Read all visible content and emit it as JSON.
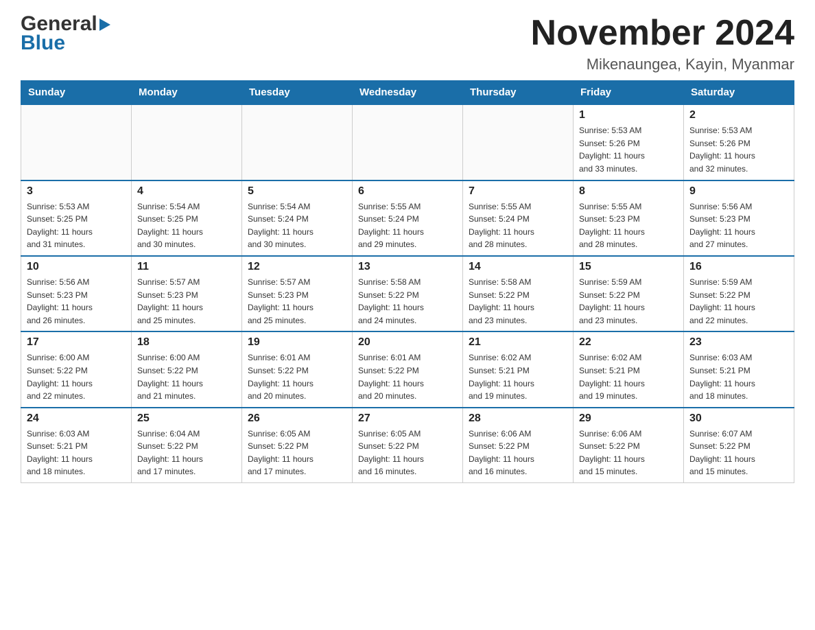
{
  "logo": {
    "general": "General",
    "arrow": "",
    "blue": "Blue"
  },
  "title": "November 2024",
  "location": "Mikenaungea, Kayin, Myanmar",
  "weekdays": [
    "Sunday",
    "Monday",
    "Tuesday",
    "Wednesday",
    "Thursday",
    "Friday",
    "Saturday"
  ],
  "weeks": [
    [
      {
        "day": "",
        "info": ""
      },
      {
        "day": "",
        "info": ""
      },
      {
        "day": "",
        "info": ""
      },
      {
        "day": "",
        "info": ""
      },
      {
        "day": "",
        "info": ""
      },
      {
        "day": "1",
        "info": "Sunrise: 5:53 AM\nSunset: 5:26 PM\nDaylight: 11 hours\nand 33 minutes."
      },
      {
        "day": "2",
        "info": "Sunrise: 5:53 AM\nSunset: 5:26 PM\nDaylight: 11 hours\nand 32 minutes."
      }
    ],
    [
      {
        "day": "3",
        "info": "Sunrise: 5:53 AM\nSunset: 5:25 PM\nDaylight: 11 hours\nand 31 minutes."
      },
      {
        "day": "4",
        "info": "Sunrise: 5:54 AM\nSunset: 5:25 PM\nDaylight: 11 hours\nand 30 minutes."
      },
      {
        "day": "5",
        "info": "Sunrise: 5:54 AM\nSunset: 5:24 PM\nDaylight: 11 hours\nand 30 minutes."
      },
      {
        "day": "6",
        "info": "Sunrise: 5:55 AM\nSunset: 5:24 PM\nDaylight: 11 hours\nand 29 minutes."
      },
      {
        "day": "7",
        "info": "Sunrise: 5:55 AM\nSunset: 5:24 PM\nDaylight: 11 hours\nand 28 minutes."
      },
      {
        "day": "8",
        "info": "Sunrise: 5:55 AM\nSunset: 5:23 PM\nDaylight: 11 hours\nand 28 minutes."
      },
      {
        "day": "9",
        "info": "Sunrise: 5:56 AM\nSunset: 5:23 PM\nDaylight: 11 hours\nand 27 minutes."
      }
    ],
    [
      {
        "day": "10",
        "info": "Sunrise: 5:56 AM\nSunset: 5:23 PM\nDaylight: 11 hours\nand 26 minutes."
      },
      {
        "day": "11",
        "info": "Sunrise: 5:57 AM\nSunset: 5:23 PM\nDaylight: 11 hours\nand 25 minutes."
      },
      {
        "day": "12",
        "info": "Sunrise: 5:57 AM\nSunset: 5:23 PM\nDaylight: 11 hours\nand 25 minutes."
      },
      {
        "day": "13",
        "info": "Sunrise: 5:58 AM\nSunset: 5:22 PM\nDaylight: 11 hours\nand 24 minutes."
      },
      {
        "day": "14",
        "info": "Sunrise: 5:58 AM\nSunset: 5:22 PM\nDaylight: 11 hours\nand 23 minutes."
      },
      {
        "day": "15",
        "info": "Sunrise: 5:59 AM\nSunset: 5:22 PM\nDaylight: 11 hours\nand 23 minutes."
      },
      {
        "day": "16",
        "info": "Sunrise: 5:59 AM\nSunset: 5:22 PM\nDaylight: 11 hours\nand 22 minutes."
      }
    ],
    [
      {
        "day": "17",
        "info": "Sunrise: 6:00 AM\nSunset: 5:22 PM\nDaylight: 11 hours\nand 22 minutes."
      },
      {
        "day": "18",
        "info": "Sunrise: 6:00 AM\nSunset: 5:22 PM\nDaylight: 11 hours\nand 21 minutes."
      },
      {
        "day": "19",
        "info": "Sunrise: 6:01 AM\nSunset: 5:22 PM\nDaylight: 11 hours\nand 20 minutes."
      },
      {
        "day": "20",
        "info": "Sunrise: 6:01 AM\nSunset: 5:22 PM\nDaylight: 11 hours\nand 20 minutes."
      },
      {
        "day": "21",
        "info": "Sunrise: 6:02 AM\nSunset: 5:21 PM\nDaylight: 11 hours\nand 19 minutes."
      },
      {
        "day": "22",
        "info": "Sunrise: 6:02 AM\nSunset: 5:21 PM\nDaylight: 11 hours\nand 19 minutes."
      },
      {
        "day": "23",
        "info": "Sunrise: 6:03 AM\nSunset: 5:21 PM\nDaylight: 11 hours\nand 18 minutes."
      }
    ],
    [
      {
        "day": "24",
        "info": "Sunrise: 6:03 AM\nSunset: 5:21 PM\nDaylight: 11 hours\nand 18 minutes."
      },
      {
        "day": "25",
        "info": "Sunrise: 6:04 AM\nSunset: 5:22 PM\nDaylight: 11 hours\nand 17 minutes."
      },
      {
        "day": "26",
        "info": "Sunrise: 6:05 AM\nSunset: 5:22 PM\nDaylight: 11 hours\nand 17 minutes."
      },
      {
        "day": "27",
        "info": "Sunrise: 6:05 AM\nSunset: 5:22 PM\nDaylight: 11 hours\nand 16 minutes."
      },
      {
        "day": "28",
        "info": "Sunrise: 6:06 AM\nSunset: 5:22 PM\nDaylight: 11 hours\nand 16 minutes."
      },
      {
        "day": "29",
        "info": "Sunrise: 6:06 AM\nSunset: 5:22 PM\nDaylight: 11 hours\nand 15 minutes."
      },
      {
        "day": "30",
        "info": "Sunrise: 6:07 AM\nSunset: 5:22 PM\nDaylight: 11 hours\nand 15 minutes."
      }
    ]
  ]
}
